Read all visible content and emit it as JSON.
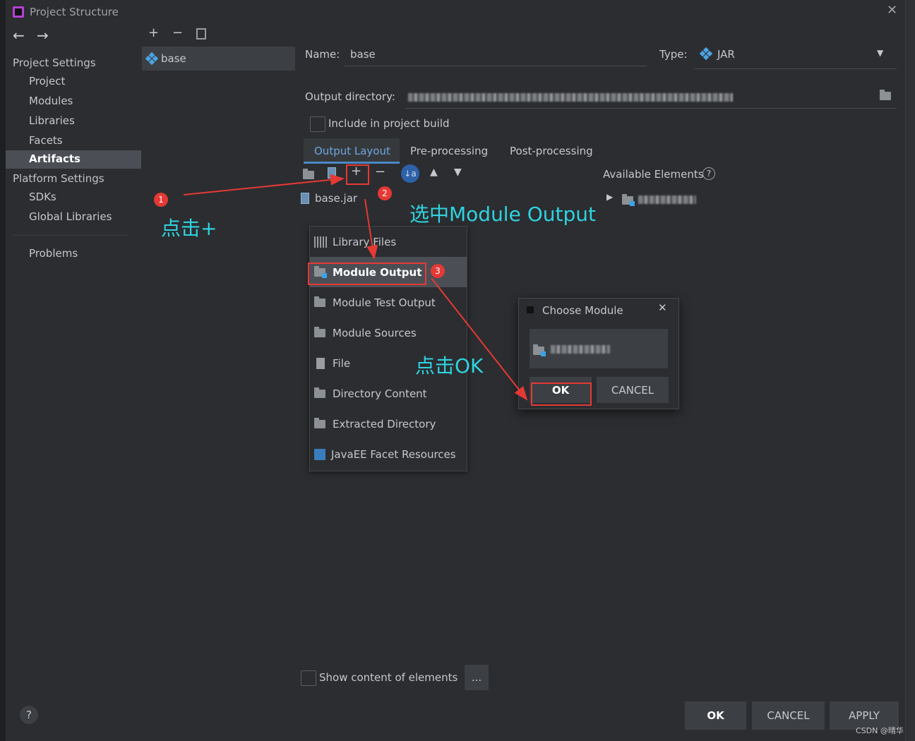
{
  "window": {
    "title": "Project Structure"
  },
  "sidebar": {
    "project_settings": "Project Settings",
    "items": [
      "Project",
      "Modules",
      "Libraries",
      "Facets",
      "Artifacts"
    ],
    "platform_settings": "Platform Settings",
    "platform_items": [
      "SDKs",
      "Global Libraries"
    ],
    "problems": "Problems"
  },
  "artifact_list": {
    "selected": "base"
  },
  "form": {
    "name_label": "Name:",
    "name_value": "base",
    "type_label": "Type:",
    "type_value": "JAR",
    "output_label": "Output directory:",
    "include_label": "Include in project build"
  },
  "tabs": [
    "Output Layout",
    "Pre-processing",
    "Post-processing"
  ],
  "layout": {
    "root_item": "base.jar",
    "available_label": "Available Elements"
  },
  "add_menu": {
    "items": [
      "Library Files",
      "Module Output",
      "Module Test Output",
      "Module Sources",
      "File",
      "Directory Content",
      "Extracted Directory",
      "JavaEE Facet Resources"
    ]
  },
  "choose_module": {
    "title": "Choose Module",
    "ok": "OK",
    "cancel": "CANCEL"
  },
  "annotations": {
    "n1": "1",
    "n2": "2",
    "n3": "3",
    "click_plus": "点击+",
    "select_module_output": "选中Module Output",
    "click_ok": "点击OK"
  },
  "bottom": {
    "show_content": "Show content of elements",
    "more": "...",
    "ok": "OK",
    "cancel": "CANCEL",
    "apply": "APPLY",
    "help": "?"
  },
  "watermark": "CSDN @晴华"
}
